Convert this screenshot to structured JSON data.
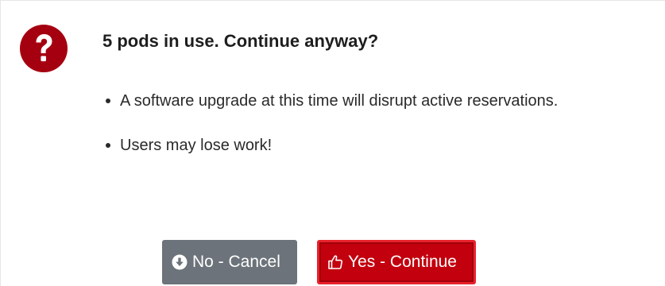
{
  "dialog": {
    "icon": "question-circle-icon",
    "title": "5 pods in use. Continue anyway?",
    "bullets": [
      "A software upgrade at this time will disrupt active reservations.",
      "Users may lose work!"
    ]
  },
  "buttons": {
    "cancel": {
      "label": "No - Cancel",
      "icon": "circle-arrow-down-icon",
      "color": "#6c737a"
    },
    "continue": {
      "label": "Yes - Continue",
      "icon": "thumbs-up-icon",
      "color": "#c3000e"
    }
  },
  "colors": {
    "accent": "#a50010"
  }
}
